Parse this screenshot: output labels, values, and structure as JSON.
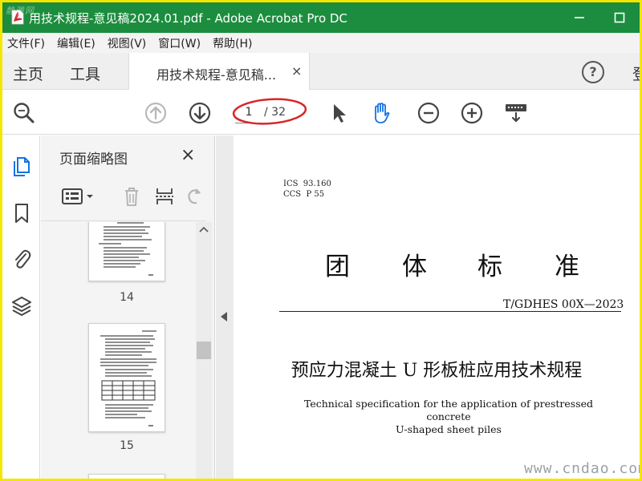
{
  "window": {
    "title": "用技术规程-意见稿2024.01.pdf - Adobe Acrobat Pro DC",
    "corner_watermark": "静雅网"
  },
  "menubar": {
    "items": [
      "文件(F)",
      "编辑(E)",
      "视图(V)",
      "窗口(W)",
      "帮助(H)"
    ]
  },
  "tabs": {
    "home": "主页",
    "tools": "工具",
    "document": "用技术规程-意见稿...",
    "close_glyph": "×",
    "help_glyph": "?",
    "login_partial": "登"
  },
  "toolbar": {
    "current_page": "1",
    "total_pages": "/ 32"
  },
  "thumbnails_panel": {
    "title": "页面缩略图",
    "close_glyph": "×",
    "pages": [
      "14",
      "15"
    ]
  },
  "document": {
    "ics": "ICS  93.160\nCCS  P 55",
    "big_title_chars": [
      "团",
      "体",
      "标",
      "准"
    ],
    "standard_number": "T/GDHES 00X—2023",
    "title_cn": "预应力混凝土 U 形板桩应用技术规程",
    "title_en_line1": "Technical specification for the application of prestressed concrete",
    "title_en_line2": "U-shaped sheet piles"
  },
  "site_watermark": "www.cndao.com",
  "colors": {
    "titlebar": "#1c8d3e",
    "border": "#f5e600",
    "hand_tool": "#1473e6",
    "annotation_ellipse": "#d8262a"
  }
}
